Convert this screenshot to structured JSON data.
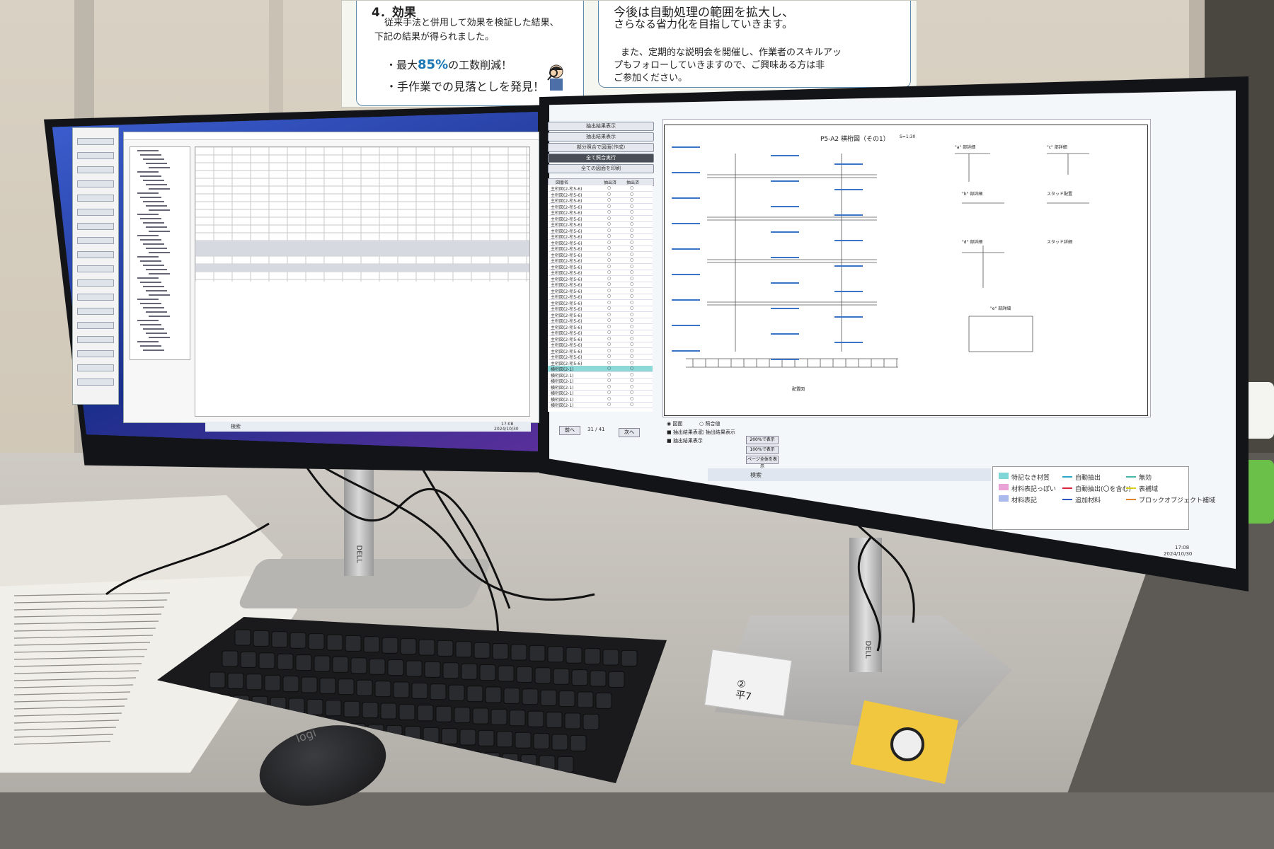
{
  "poster": {
    "left_heading": "4．効果",
    "left_body_line1": "従来手法と併用して効果を検証した結果、",
    "left_body_line2": "下記の結果が得られました。",
    "bullet1_prefix": "・最大",
    "bullet1_value": "85%",
    "bullet1_suffix": "の工数削減！",
    "bullet2": "・手作業での見落としを発見！",
    "right_line1": "今後は自動処理の範囲を拡大し、",
    "right_line2": "さらなる省力化を目指していきます。",
    "right_line3": "また、定期的な説明会を開催し、作業者のスキルアッ",
    "right_line4": "プもフォローしていきますので、ご興味ある方は非",
    "right_line5": "ご参加ください。"
  },
  "right_screen": {
    "buttons": [
      "抽出結果表示",
      "抽出結果表示",
      "部分照合で図面(作成)",
      "全て照合実行",
      "全ての図面を印刷"
    ],
    "active_button_index": 3,
    "list_header": [
      "図番名",
      "抽出済",
      "抽出済"
    ],
    "list_rows": [
      "主桁図(2-桁5-6)",
      "主桁図(2-桁5-6)",
      "主桁図(2-桁5-6)",
      "主桁図(2-桁5-6)",
      "主桁図(2-桁5-6)",
      "主桁図(2-桁5-6)",
      "主桁図(2-桁5-6)",
      "主桁図(2-桁5-6)",
      "主桁図(2-桁5-6)",
      "主桁図(2-桁5-6)",
      "主桁図(2-桁5-6)",
      "主桁図(2-桁5-6)",
      "主桁図(2-桁5-6)",
      "主桁図(2-桁5-6)",
      "主桁図(2-桁5-6)",
      "主桁図(2-桁5-6)",
      "主桁図(2-桁5-6)",
      "主桁図(2-桁5-6)",
      "主桁図(2-桁5-6)",
      "主桁図(2-桁5-6)",
      "主桁図(2-桁5-6)",
      "主桁図(2-桁5-6)",
      "主桁図(2-桁5-6)",
      "主桁図(2-桁5-6)",
      "主桁図(2-桁5-6)",
      "主桁図(2-桁5-6)",
      "主桁図(2-桁5-6)",
      "主桁図(2-桁5-6)",
      "主桁図(2-桁5-6)",
      "主桁図(2-桁5-6)",
      "横桁図(2-1)",
      "横桁図(2-1)",
      "横桁図(2-1)",
      "横桁図(2-1)",
      "横桁図(2-1)",
      "横桁図(2-1)",
      "横桁図(2-1)"
    ],
    "selected_row_index": 30,
    "prev_button": "前へ",
    "next_button": "次へ",
    "page_indicator": "31 / 41",
    "radio_1": "図面",
    "radio_2": "照合値",
    "check_1": "抽出結果表示",
    "check_2": "抽出結果表示",
    "check_3": "抽出結果表示",
    "zoom_btn_1": "200%で表示",
    "zoom_btn_2": "100%で表示",
    "zoom_btn_3": "ページ全体を表示",
    "drawing_title": "P5-A2 横桁図（その1）",
    "drawing_scale": "S=1:30",
    "detail_labels": [
      "\"a\" 部詳細",
      "\"c\" 部詳細",
      "\"b\" 部詳細",
      "スタッド配置",
      "\"d\" 部詳細",
      "スタッド詳細",
      "\"e\" 部詳細"
    ],
    "drawing_footer": "配置図",
    "clock_time": "17:08",
    "clock_date": "2024/10/30"
  },
  "legend": {
    "items": [
      {
        "label": "特記なき材質",
        "color": "#7fd6d6"
      },
      {
        "label": "材料表記っぽい",
        "color": "#e9a3d6"
      },
      {
        "label": "材料表記",
        "color": "#a9b9ec"
      },
      {
        "label": "自動抽出",
        "color": "#2aa6c9"
      },
      {
        "label": "自動抽出(〇を含む)",
        "color": "#d8263d"
      },
      {
        "label": "追加材料",
        "color": "#2f55c2"
      },
      {
        "label": "無効",
        "color": "#46b6a8"
      },
      {
        "label": "表補域",
        "color": "#d7d11c"
      },
      {
        "label": "ブロックオブジェクト補域",
        "color": "#e1852d"
      }
    ]
  },
  "taskbar": {
    "left_search": "検索",
    "left_time": "17:08",
    "left_date": "2024/10/30",
    "right_search": "検索"
  },
  "label_sticker": "②\n平7",
  "mouse_logo": "logi",
  "monitor_brand": "DELL"
}
